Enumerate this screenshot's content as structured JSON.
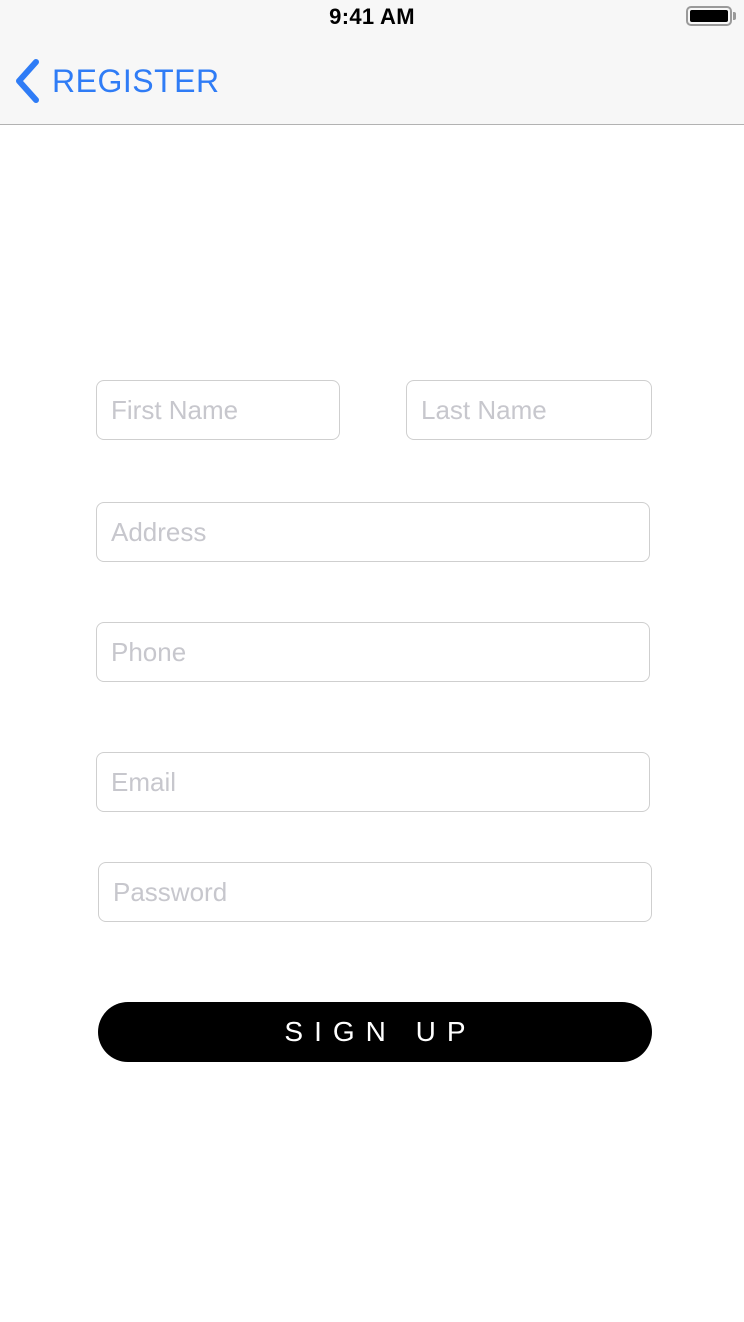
{
  "status_bar": {
    "time": "9:41 AM",
    "battery_icon": "battery-full-icon"
  },
  "nav": {
    "back_icon": "chevron-left-icon",
    "back_label": "REGISTER",
    "accent_color": "#2f7cf6"
  },
  "form": {
    "first_name": {
      "placeholder": "First Name",
      "value": ""
    },
    "last_name": {
      "placeholder": "Last Name",
      "value": ""
    },
    "address": {
      "placeholder": "Address",
      "value": ""
    },
    "phone": {
      "placeholder": "Phone",
      "value": ""
    },
    "email": {
      "placeholder": "Email",
      "value": ""
    },
    "password": {
      "placeholder": "Password",
      "value": ""
    },
    "submit_label": "SIGN UP"
  }
}
